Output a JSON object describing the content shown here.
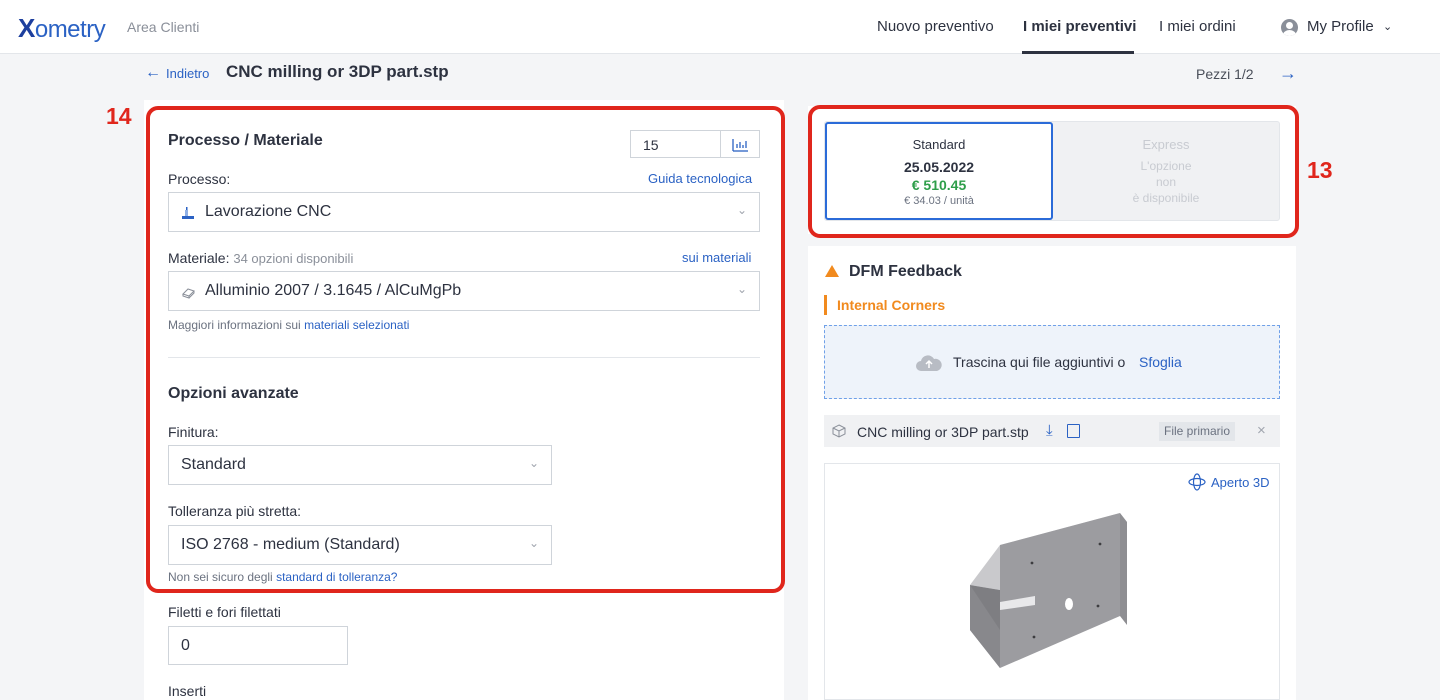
{
  "nav": {
    "logo_x": "X",
    "logo_rest": "ometry",
    "area": "Area Clienti",
    "links": [
      "Nuovo preventivo",
      "I miei preventivi",
      "I miei ordini"
    ],
    "profile": "My Profile"
  },
  "subheader": {
    "back_label": "Indietro",
    "title": "CNC milling or 3DP part.stp",
    "pieces": "Pezzi 1/2"
  },
  "annotations": {
    "left": "14",
    "right": "13"
  },
  "config": {
    "section_title": "Processo / Materiale",
    "quantity": "15",
    "process_label": "Processo:",
    "process_link": "Guida tecnologica",
    "process_value": "Lavorazione CNC",
    "material_label": "Materiale:",
    "material_options": "34 opzioni disponibili",
    "material_link": "sui materiali",
    "material_value": "Alluminio 2007 / 3.1645 / AlCuMgPb",
    "material_info_prefix": "Maggiori informazioni sui",
    "material_info_link": "materiali selezionati",
    "advanced_title": "Opzioni avanzate",
    "finish_label": "Finitura:",
    "finish_value": "Standard",
    "tolerance_label": "Tolleranza più stretta:",
    "tolerance_value": "ISO 2768 - medium (Standard)",
    "tolerance_help_prefix": "Non sei sicuro degli",
    "tolerance_help_link": "standard di tolleranza?",
    "threads_label": "Filetti e fori filettati",
    "threads_value": "0",
    "inserts_label": "Inserti"
  },
  "quote": {
    "standard": {
      "title": "Standard",
      "date": "25.05.2022",
      "price": "€ 510.45",
      "unit": "€ 34.03 / unità"
    },
    "express": {
      "title": "Express",
      "line1": "L'opzione",
      "line2": "non",
      "line3": "è disponibile"
    }
  },
  "dfm": {
    "title": "DFM Feedback",
    "issue": "Internal Corners",
    "drop_text": "Trascina qui file aggiuntivi o",
    "drop_link": "Sfoglia",
    "file_name": "CNC milling or 3DP part.stp",
    "primary_badge": "File primario",
    "close": "×",
    "open3d": "Aperto 3D"
  },
  "colors": {
    "brand": "#2b62c4",
    "annotation_red": "#e0261c",
    "price_green": "#2e9e4a",
    "warning_orange": "#f18a1e"
  }
}
